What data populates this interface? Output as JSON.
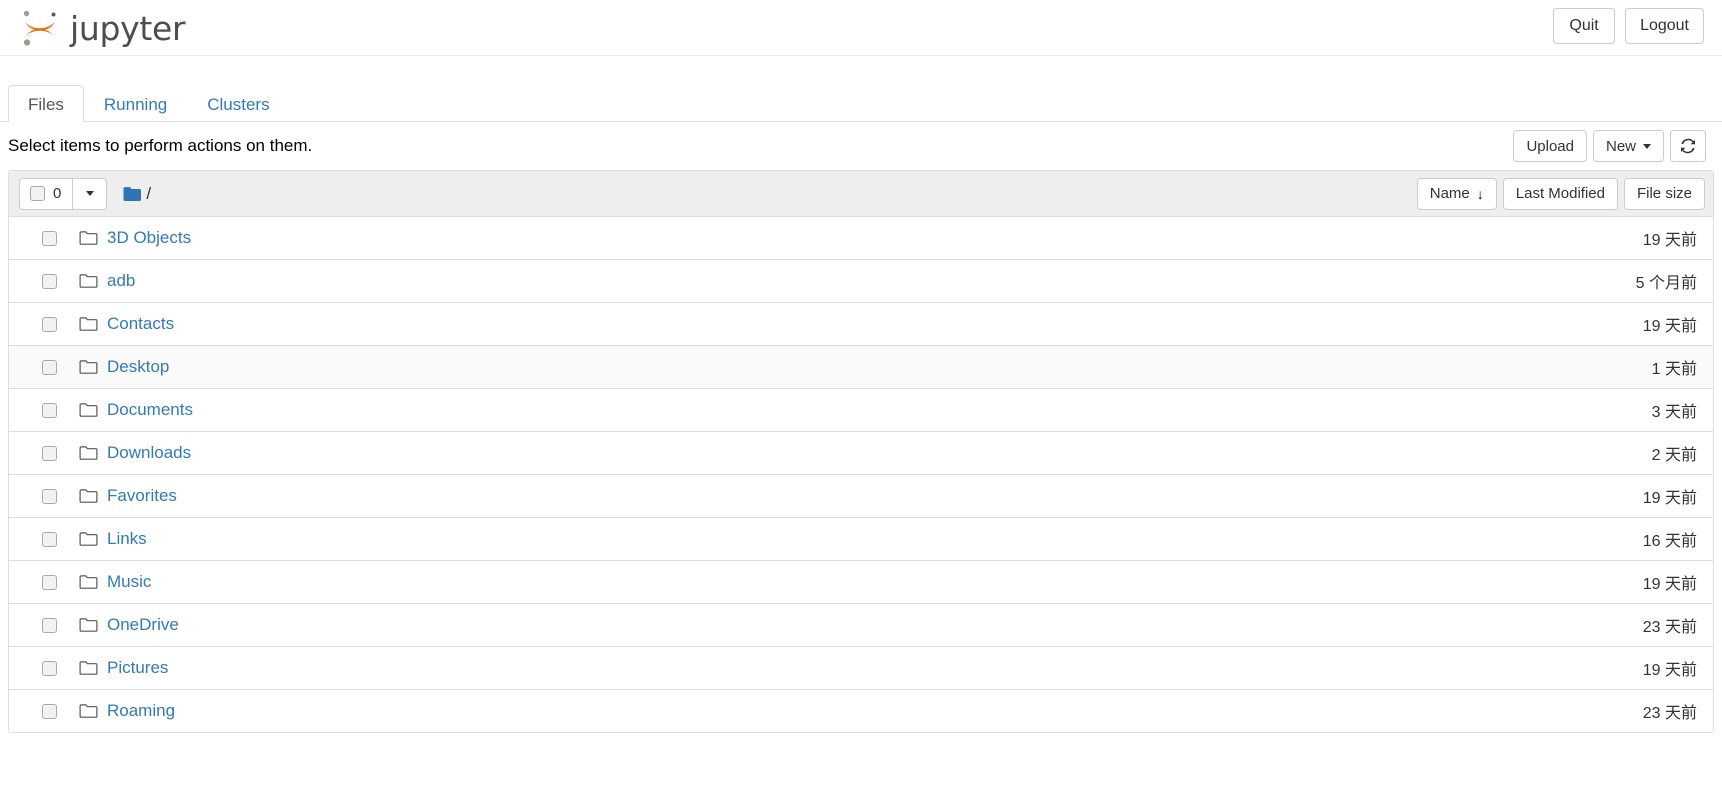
{
  "header": {
    "brand_text": "jupyter",
    "logo_icon": "jupyter-logo-icon",
    "logo_color_arc": "#e8710a",
    "logo_color_dot": "#888888",
    "quit_label": "Quit",
    "logout_label": "Logout"
  },
  "tabs": [
    {
      "label": "Files",
      "active": true
    },
    {
      "label": "Running",
      "active": false
    },
    {
      "label": "Clusters",
      "active": false
    }
  ],
  "action_row": {
    "hint": "Select items to perform actions on them.",
    "upload_label": "Upload",
    "new_label": "New",
    "new_caret_icon": "chevron-down-icon",
    "refresh_icon": "refresh-icon"
  },
  "list_header": {
    "select_count": "0",
    "select_caret_icon": "chevron-down-icon",
    "breadcrumb_folder_icon": "folder-filled-icon",
    "breadcrumb_path": "/",
    "sort_name_label": "Name",
    "sort_name_arrow": "↓",
    "sort_modified_label": "Last Modified",
    "sort_size_label": "File size"
  },
  "accent_colors": {
    "link": "#337ab7",
    "header_bg": "#eeeeee",
    "border": "#dddddd",
    "folder_blue": "#337ab7"
  },
  "files": [
    {
      "name": "3D Objects",
      "icon": "folder-icon",
      "modified": "19 天前",
      "size": "",
      "hovered": false
    },
    {
      "name": "adb",
      "icon": "folder-icon",
      "modified": "5 个月前",
      "size": "",
      "hovered": false
    },
    {
      "name": "Contacts",
      "icon": "folder-icon",
      "modified": "19 天前",
      "size": "",
      "hovered": false
    },
    {
      "name": "Desktop",
      "icon": "folder-icon",
      "modified": "1 天前",
      "size": "",
      "hovered": true
    },
    {
      "name": "Documents",
      "icon": "folder-icon",
      "modified": "3 天前",
      "size": "",
      "hovered": false
    },
    {
      "name": "Downloads",
      "icon": "folder-icon",
      "modified": "2 天前",
      "size": "",
      "hovered": false
    },
    {
      "name": "Favorites",
      "icon": "folder-icon",
      "modified": "19 天前",
      "size": "",
      "hovered": false
    },
    {
      "name": "Links",
      "icon": "folder-icon",
      "modified": "16 天前",
      "size": "",
      "hovered": false
    },
    {
      "name": "Music",
      "icon": "folder-icon",
      "modified": "19 天前",
      "size": "",
      "hovered": false
    },
    {
      "name": "OneDrive",
      "icon": "folder-icon",
      "modified": "23 天前",
      "size": "",
      "hovered": false
    },
    {
      "name": "Pictures",
      "icon": "folder-icon",
      "modified": "19 天前",
      "size": "",
      "hovered": false
    },
    {
      "name": "Roaming",
      "icon": "folder-icon",
      "modified": "23 天前",
      "size": "",
      "hovered": false
    }
  ]
}
